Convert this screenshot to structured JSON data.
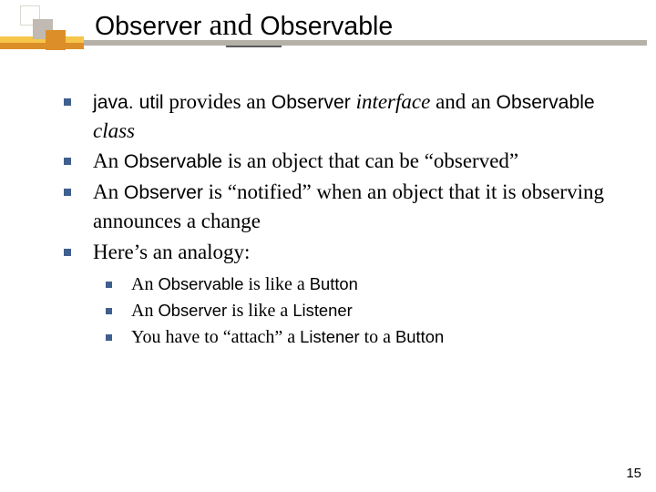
{
  "title": {
    "w1": "Observer",
    "w_and": " and ",
    "w2": "Observable"
  },
  "bullets": {
    "b1": {
      "t1": "java. util",
      "t2": " provides an ",
      "t3": "Observer",
      "t4": " interface",
      "t5": " and an ",
      "t6": "Observable",
      "t7": " class"
    },
    "b2": {
      "t1": "An ",
      "t2": "Observable",
      "t3": " is an object that can be “observed”"
    },
    "b3": {
      "t1": "An ",
      "t2": "Observer",
      "t3": " is “notified” when an object that it is observing announces a change"
    },
    "b4": {
      "t1": "Here’s an analogy:"
    }
  },
  "sub": {
    "s1": {
      "t1": "An ",
      "t2": "Observable",
      "t3": " is like a ",
      "t4": "Button"
    },
    "s2": {
      "t1": "An ",
      "t2": "Observer",
      "t3": " is like a ",
      "t4": "Listener"
    },
    "s3": {
      "t1": "You have to “attach” a ",
      "t2": "Listener",
      "t3": " to a ",
      "t4": "Button"
    }
  },
  "pagenum": "15"
}
